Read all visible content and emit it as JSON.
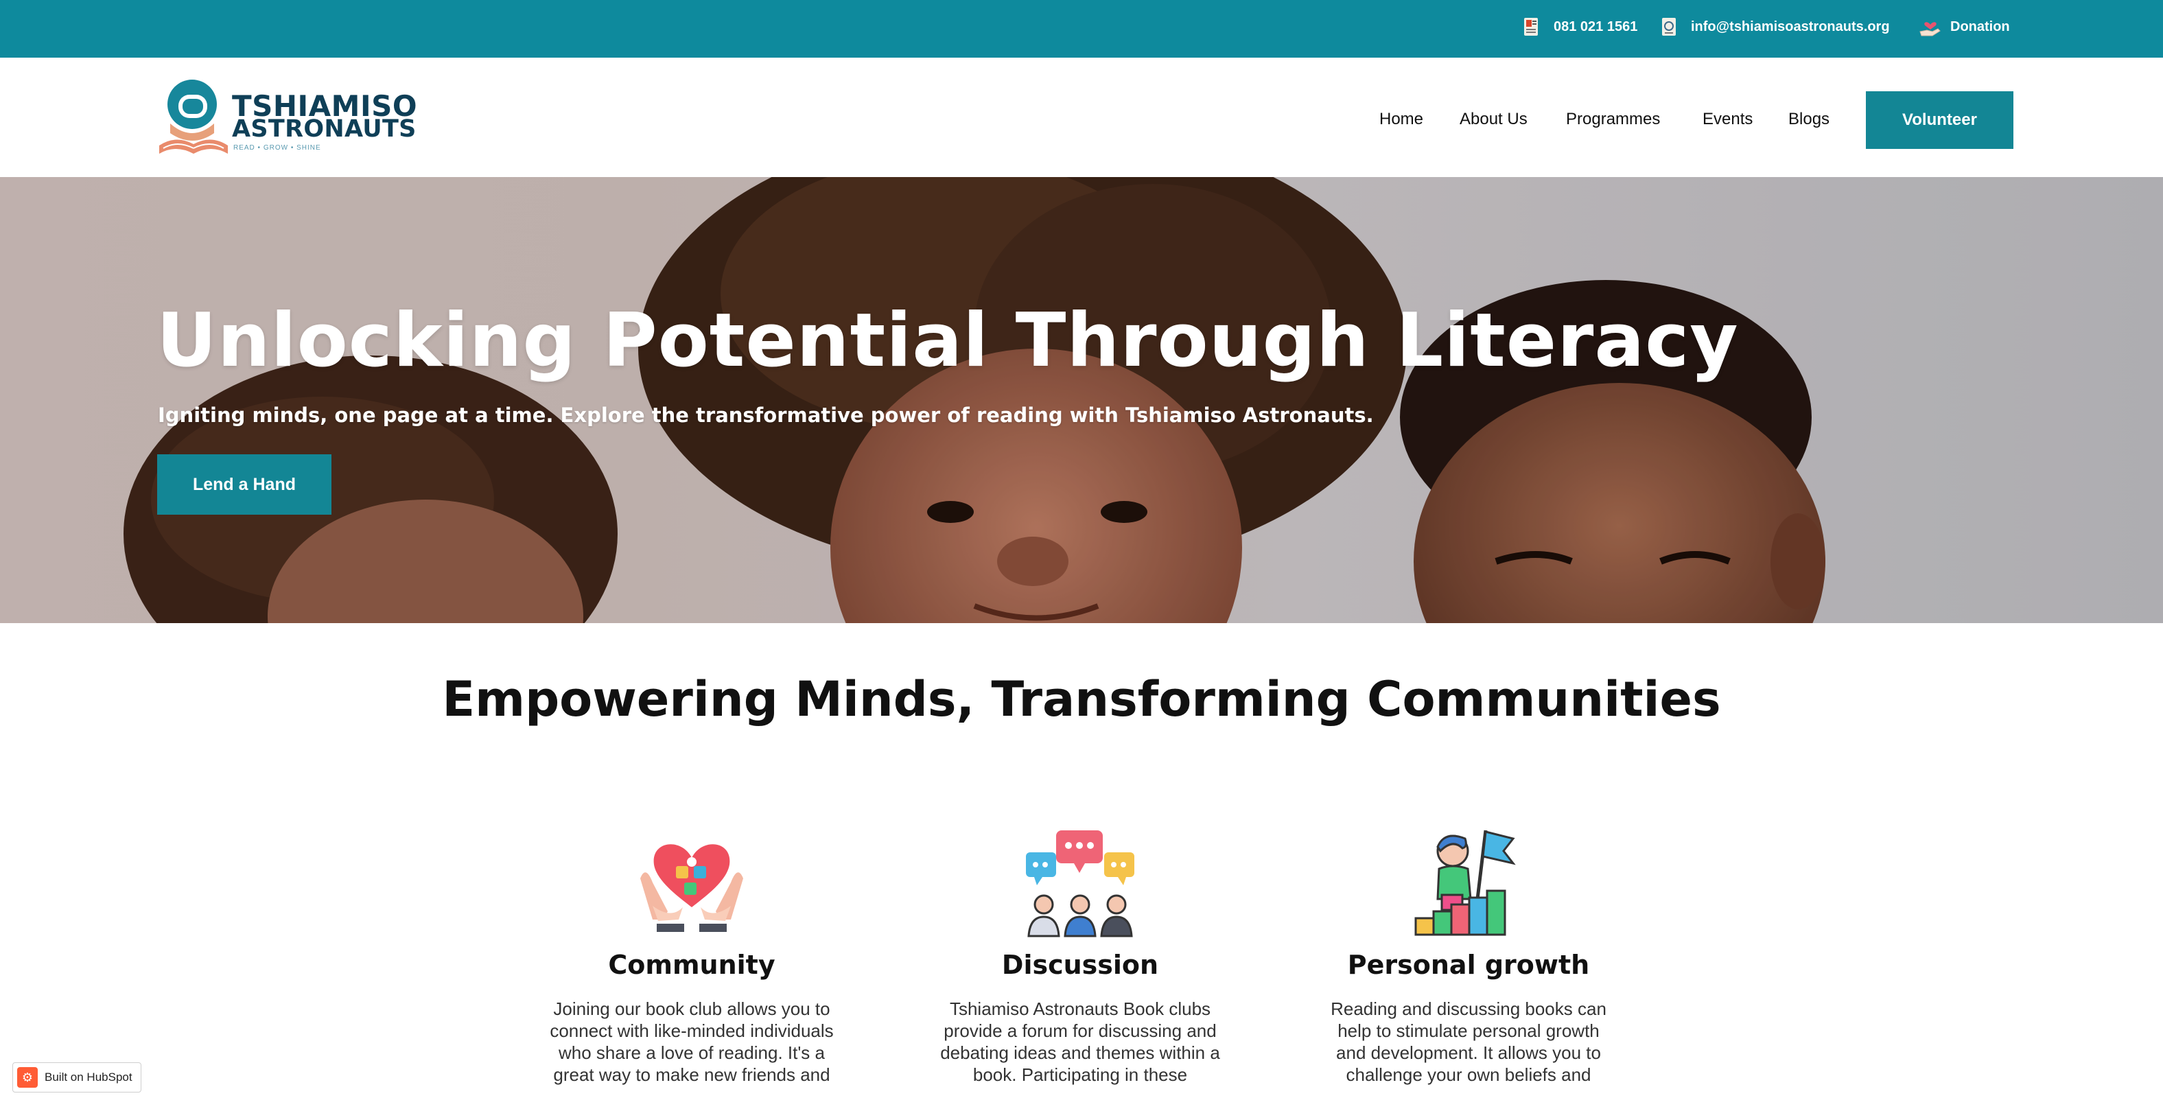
{
  "topbar": {
    "phone": "081 021 1561",
    "email": "info@tshiamisoastronauts.org",
    "donation": "Donation"
  },
  "brand": {
    "line1": "TSHIAMISO",
    "line2": "ASTRONAUTS",
    "tagline": "READ • GROW • SHINE"
  },
  "nav": {
    "items": [
      {
        "label": "Home"
      },
      {
        "label": "About Us"
      },
      {
        "label": "Programmes"
      },
      {
        "label": "Events"
      },
      {
        "label": "Blogs"
      }
    ],
    "cta": "Volunteer"
  },
  "hero": {
    "title": "Unlocking Potential Through Literacy",
    "subtitle": "Igniting minds, one page at a time. Explore the transformative power of reading with Tshiamiso Astronauts.",
    "button": "Lend a Hand"
  },
  "section": {
    "title": "Empowering Minds, Transforming Communities",
    "features": [
      {
        "icon": "heart-hands-icon",
        "title": "Community",
        "desc": "Joining our book club allows you to connect with like-minded individuals who share a love of reading. It's a great way to make new friends and"
      },
      {
        "icon": "discussion-icon",
        "title": "Discussion",
        "desc": "Tshiamiso Astronauts Book clubs provide a forum for discussing and debating ideas and themes within a book. Participating in these"
      },
      {
        "icon": "growth-flag-icon",
        "title": "Personal growth",
        "desc": "Reading and discussing books can help to stimulate personal growth and development. It allows you to challenge your own beliefs and"
      }
    ]
  },
  "badge": {
    "label": "Built on HubSpot"
  },
  "colors": {
    "teal": "#0e8a9d",
    "button": "#138695",
    "navy": "#0f3f57"
  }
}
